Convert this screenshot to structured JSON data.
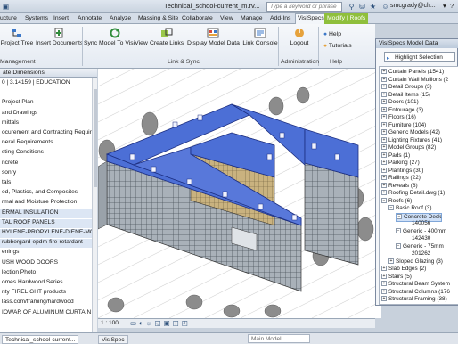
{
  "titlebar": {
    "left_tabs": [
      "ucture",
      "Systems",
      "Insert",
      "Annotate",
      "Analyze",
      "Massing & Site",
      "Collaborate",
      "View",
      "Manage",
      "Add-Ins",
      "VisiSpecs",
      "Modify | Roofs"
    ],
    "doc_title": "Technical_school-current_m.rv...",
    "search_placeholder": "Type a keyword or phrase",
    "user": "smcgrady@ch..."
  },
  "ribbon": {
    "buttons": [
      "Project Tree",
      "Insert Documents",
      "Sync Model To VisiView",
      "Create Links",
      "Display Model Data",
      "Link Console",
      "Logout"
    ],
    "small": [
      "Help",
      "Tutorials"
    ],
    "panels": [
      "Management",
      "Link & Sync",
      "Administration",
      "Help"
    ]
  },
  "props": {
    "header": "ate Dimensions",
    "rows": [
      "0 | 3.14159 | EDUCATION",
      "",
      "Project Plan",
      "and Drawings",
      "mittals",
      "ocurement and Contracting Requirer",
      "neral Requirements",
      "sting Conditions",
      "ncrete",
      "sonry",
      "tals",
      "od, Plastics, and Composites",
      "rmal and Moisture Protection",
      "ERMAL INSULATION",
      "TAL ROOF PANELS",
      "HYLENE-PROPYLENE-DIENE-MONON",
      "rubbergard-epdm-fire-retardant",
      "enings",
      "USH WOOD DOORS",
      "lection Photo",
      "omes Hardwood Series",
      "nty FIRELIGHT products",
      "lass.com/framing/hardwood",
      "IOWAR OF ALUMINUM CURTAIN"
    ]
  },
  "viewbar": {
    "scale": "1 : 100"
  },
  "vpanel": {
    "title": "VisiSpecs Model Data",
    "highlight": "Highlight Selection",
    "tree": [
      {
        "label": "Curtain Panels (1541)",
        "lvl": 0,
        "pm": "+"
      },
      {
        "label": "Curtain Wall Mullions (2",
        "lvl": 0,
        "pm": "+"
      },
      {
        "label": "Detail Groups (3)",
        "lvl": 0,
        "pm": "+"
      },
      {
        "label": "Detail Items (15)",
        "lvl": 0,
        "pm": "+"
      },
      {
        "label": "Doors (101)",
        "lvl": 0,
        "pm": "+"
      },
      {
        "label": "Entourage (3)",
        "lvl": 0,
        "pm": "+"
      },
      {
        "label": "Floors (16)",
        "lvl": 0,
        "pm": "+"
      },
      {
        "label": "Furniture (104)",
        "lvl": 0,
        "pm": "+"
      },
      {
        "label": "Generic Models (42)",
        "lvl": 0,
        "pm": "+"
      },
      {
        "label": "Lighting Fixtures (41)",
        "lvl": 0,
        "pm": "+"
      },
      {
        "label": "Model Groups (82)",
        "lvl": 0,
        "pm": "+"
      },
      {
        "label": "Pads (1)",
        "lvl": 0,
        "pm": "+"
      },
      {
        "label": "Parking (27)",
        "lvl": 0,
        "pm": "+"
      },
      {
        "label": "Plantings (30)",
        "lvl": 0,
        "pm": "+"
      },
      {
        "label": "Railings (22)",
        "lvl": 0,
        "pm": "+"
      },
      {
        "label": "Reveals (8)",
        "lvl": 0,
        "pm": "+"
      },
      {
        "label": "Roofing Detail.dwg (1)",
        "lvl": 0,
        "pm": "+"
      },
      {
        "label": "Roofs (6)",
        "lvl": 0,
        "pm": "−"
      },
      {
        "label": "Basic Roof (3)",
        "lvl": 1,
        "pm": "−"
      },
      {
        "label": "Concrete Deck",
        "lvl": 2,
        "pm": "−",
        "sel": true
      },
      {
        "label": "140056",
        "lvl": 3,
        "pm": ""
      },
      {
        "label": "Generic - 400mm",
        "lvl": 2,
        "pm": "−"
      },
      {
        "label": "142430",
        "lvl": 3,
        "pm": ""
      },
      {
        "label": "Generic - 75mm",
        "lvl": 2,
        "pm": "−"
      },
      {
        "label": "201262",
        "lvl": 3,
        "pm": ""
      },
      {
        "label": "Sloped Glazing (3)",
        "lvl": 1,
        "pm": "+"
      },
      {
        "label": "Slab Edges (2)",
        "lvl": 0,
        "pm": "+"
      },
      {
        "label": "Stairs (5)",
        "lvl": 0,
        "pm": "+"
      },
      {
        "label": "Structural Beam System",
        "lvl": 0,
        "pm": "+"
      },
      {
        "label": "Structural Columns (176",
        "lvl": 0,
        "pm": "+"
      },
      {
        "label": "Structural Framing (38)",
        "lvl": 0,
        "pm": "+"
      }
    ]
  },
  "taskbar": {
    "items": [
      "Technical_school-current...",
      "VisiSpec"
    ],
    "model": "Main Model"
  }
}
